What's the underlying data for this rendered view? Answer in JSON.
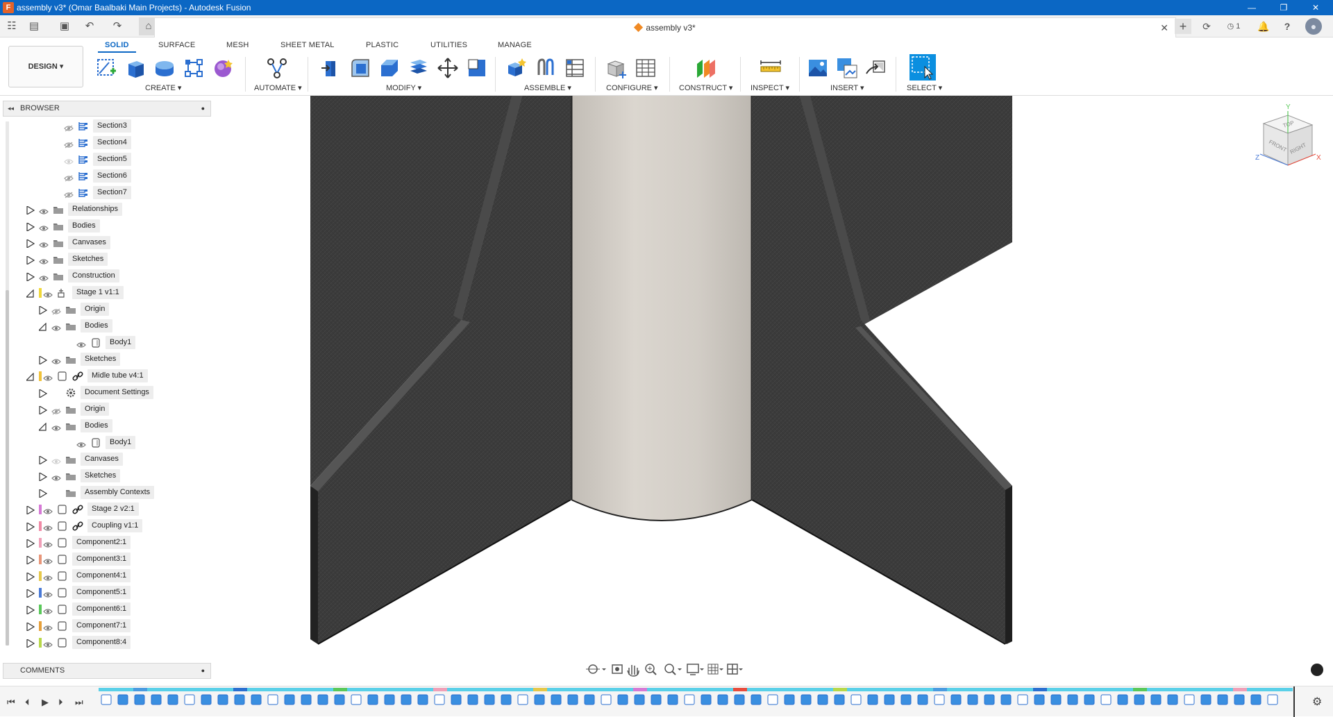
{
  "window": {
    "title": "assembly v3* (Omar Baalbaki Main Projects) - Autodesk Fusion",
    "app_icon": "F",
    "controls": [
      "—",
      "❐",
      "✕"
    ]
  },
  "qat": {
    "grid_icon": "☷",
    "file_icon": "▤",
    "save_icon": "▣",
    "undo_icon": "↶",
    "redo_icon": "↷",
    "home_icon": "⌂"
  },
  "document_tab": {
    "title": "assembly v3*",
    "close": "✕"
  },
  "right_buttons": {
    "new_tab": "+",
    "extensions": "⟳",
    "jobs_count": "1",
    "notifications": "♪",
    "help": "?",
    "avatar": "●"
  },
  "ribbon": {
    "workspace": "DESIGN ▾",
    "tabs": [
      "SOLID",
      "SURFACE",
      "MESH",
      "SHEET METAL",
      "PLASTIC",
      "UTILITIES",
      "MANAGE"
    ],
    "groups": {
      "create": "CREATE ▾",
      "automate": "AUTOMATE ▾",
      "modify": "MODIFY ▾",
      "assemble": "ASSEMBLE ▾",
      "configure": "CONFIGURE ▾",
      "construct": "CONSTRUCT ▾",
      "inspect": "INSPECT ▾",
      "insert": "INSERT ▾",
      "select": "SELECT ▾"
    }
  },
  "browser": {
    "title": "BROWSER",
    "collapse_icon": "◂◂",
    "options_icon": "●",
    "items": {
      "section3": "Section3",
      "section4": "Section4",
      "section5": "Section5",
      "section6": "Section6",
      "section7": "Section7",
      "relationships": "Relationships",
      "bodies": "Bodies",
      "canvases": "Canvases",
      "sketches": "Sketches",
      "construction": "Construction",
      "stage1": "Stage 1 v1:1",
      "stage1_origin": "Origin",
      "stage1_bodies": "Bodies",
      "stage1_body1": "Body1",
      "stage1_sketches": "Sketches",
      "midle_tube": "Midle tube v4:1",
      "mt_doc_settings": "Document Settings",
      "mt_origin": "Origin",
      "mt_bodies": "Bodies",
      "mt_body1": "Body1",
      "mt_canvases": "Canvases",
      "mt_sketches": "Sketches",
      "mt_assembly_contexts": "Assembly Contexts",
      "stage2": "Stage 2 v2:1",
      "coupling": "Coupling v1:1",
      "component2": "Component2:1",
      "component3": "Component3:1",
      "component4": "Component4:1",
      "component5": "Component5:1",
      "component6": "Component6:1",
      "component7": "Component7:1",
      "component8": "Component8:4"
    }
  },
  "comments": {
    "title": "COMMENTS",
    "options_icon": "●"
  },
  "viewcube": {
    "top": "TOP",
    "front": "FRONT",
    "right": "RIGHT",
    "axis_x": "X",
    "axis_y": "Y",
    "axis_z": "Z"
  },
  "colors": {
    "accent": "#0b67c4",
    "fin": "#3a3a3a",
    "tube": "#d6d2cc",
    "stage1": "#f0d83a",
    "midle_tube": "#f0c23a",
    "stage2": "#d67ad6",
    "coupling": "#f08aa6",
    "component2": "#f0a0b8",
    "component3": "#e8967a",
    "component4": "#e6c84a",
    "component5": "#4a7ad6",
    "component6": "#5ac85a",
    "component7": "#e6a03a",
    "component8": "#b8d84a"
  },
  "timeline": {
    "first": "⏮",
    "prev": "⏴",
    "play": "▶",
    "next": "⏵",
    "last": "⏭",
    "settings_icon": "⚙"
  }
}
